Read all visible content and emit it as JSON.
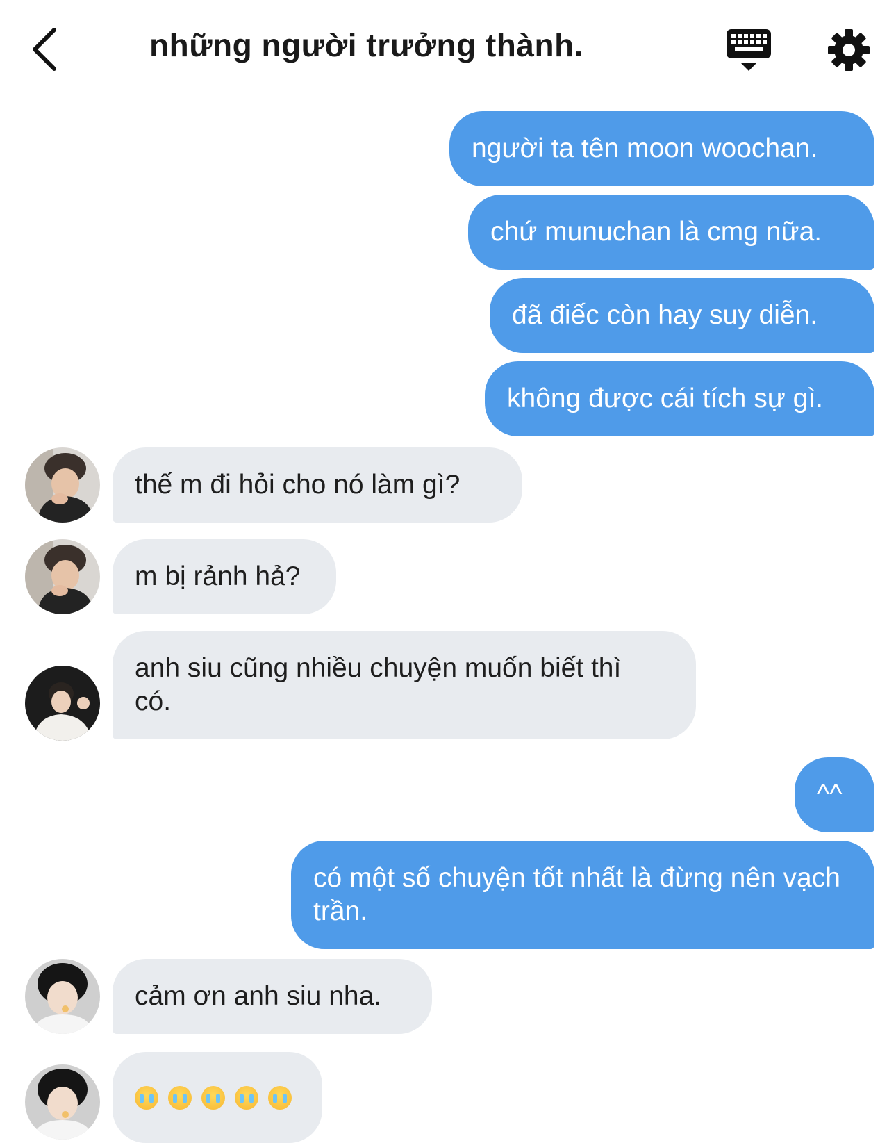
{
  "header": {
    "title": "những người trưởng thành."
  },
  "messages": [
    {
      "side": "out",
      "text": "người ta tên moon woochan."
    },
    {
      "side": "out",
      "text": "chứ munuchan là cmg nữa."
    },
    {
      "side": "out",
      "text": "đã điếc còn hay suy diễn."
    },
    {
      "side": "out",
      "text": "không được cái tích sự gì."
    },
    {
      "side": "in",
      "text": "thế m đi hỏi cho nó làm gì?"
    },
    {
      "side": "in",
      "text": "m bị rảnh hả?"
    },
    {
      "side": "in",
      "text": "anh siu cũng nhiều chuyện muốn biết thì có."
    },
    {
      "side": "out",
      "text": "^^"
    },
    {
      "side": "out",
      "text": "có một số chuyện tốt nhất là đừng nên vạch trần."
    },
    {
      "side": "in",
      "text": "cảm ơn anh siu nha."
    },
    {
      "side": "in",
      "emoji": "loudly-crying-face",
      "count": 5
    }
  ],
  "icons": {
    "back": "chevron-left-icon",
    "keyboard": "keyboard-icon",
    "settings": "gear-icon"
  },
  "colors": {
    "outgoing_bubble": "#4f9be9",
    "incoming_bubble": "#e8ebef",
    "outgoing_text": "#ffffff",
    "incoming_text": "#1e1e1e"
  }
}
